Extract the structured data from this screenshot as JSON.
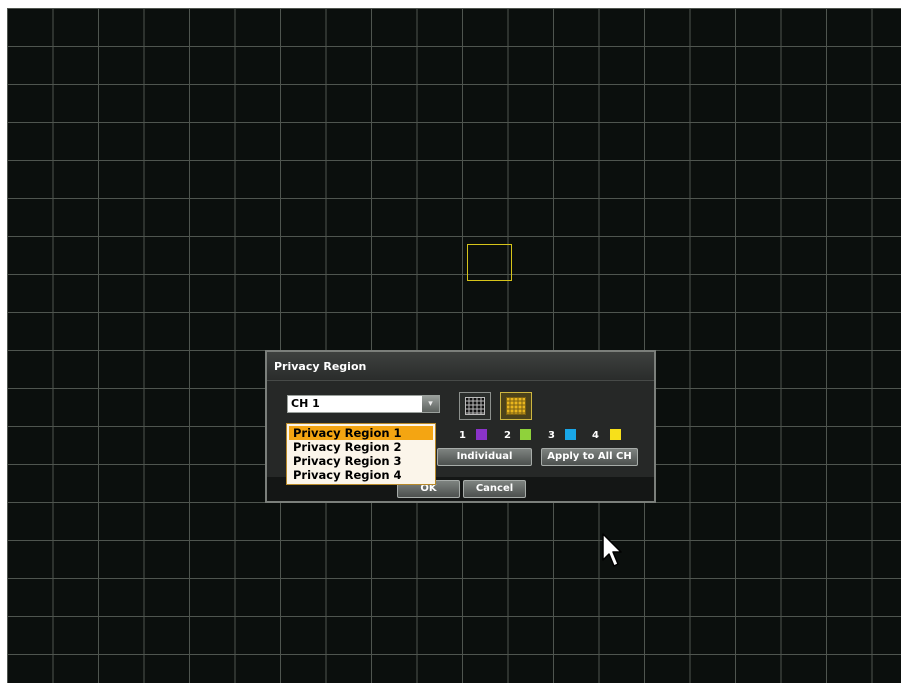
{
  "dialog": {
    "title": "Privacy Region",
    "channel": {
      "value": "CH 1",
      "dropdown_arrow": "▾"
    },
    "grid_buttons": [
      {
        "name": "grid-small",
        "selected": false
      },
      {
        "name": "grid-large",
        "selected": true
      }
    ],
    "regions": [
      {
        "label": "1",
        "color": "#8a33c9"
      },
      {
        "label": "2",
        "color": "#8fd23b"
      },
      {
        "label": "3",
        "color": "#19a7e8"
      },
      {
        "label": "4",
        "color": "#f7e01a"
      }
    ],
    "buttons": {
      "individual": "Individual",
      "apply_all": "Apply to All CH",
      "ok": "OK",
      "cancel": "Cancel"
    },
    "region_dropdown": {
      "options": [
        "Privacy Region 1",
        "Privacy Region 2",
        "Privacy Region 3",
        "Privacy Region 4"
      ],
      "selected": "Privacy Region 1"
    }
  },
  "colors": {
    "background": "#0b0f0d",
    "grid_line": "#4f554f",
    "selected_cell": "#d6c41a",
    "dropdown_highlight": "#f4a512"
  }
}
